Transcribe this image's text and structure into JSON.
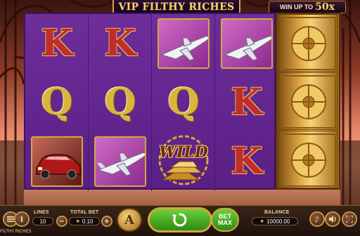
{
  "game": {
    "title": "VIP FILTHY RICHES",
    "win_up_to_label": "WIN UP TO",
    "win_up_to_value": "50x",
    "footer_title": "FILTHY RICHES"
  },
  "reels": [
    [
      "K",
      "Q",
      "car"
    ],
    [
      "K",
      "Q",
      "plane"
    ],
    [
      "plane",
      "Q",
      "wild"
    ],
    [
      "plane",
      "K",
      "K"
    ]
  ],
  "symbols": {
    "wild_label": "WILD"
  },
  "vault_reel": {
    "count": 3
  },
  "controls": {
    "lines_label": "LINES",
    "lines_value": "10",
    "total_bet_label": "TOTAL BET",
    "total_bet_value": "0.10",
    "balance_label": "BALANCE",
    "balance_value": "10000.00",
    "bet_max_line1": "BET",
    "bet_max_line2": "MAX",
    "autoplay_glyph": "A",
    "info_glyph": "i",
    "coin_glyph": "★"
  },
  "colors": {
    "gold": "#d6a640",
    "reel_purple": "#6e2e9a",
    "spin_green": "#4caf28",
    "king_red": "#c22c2c"
  }
}
